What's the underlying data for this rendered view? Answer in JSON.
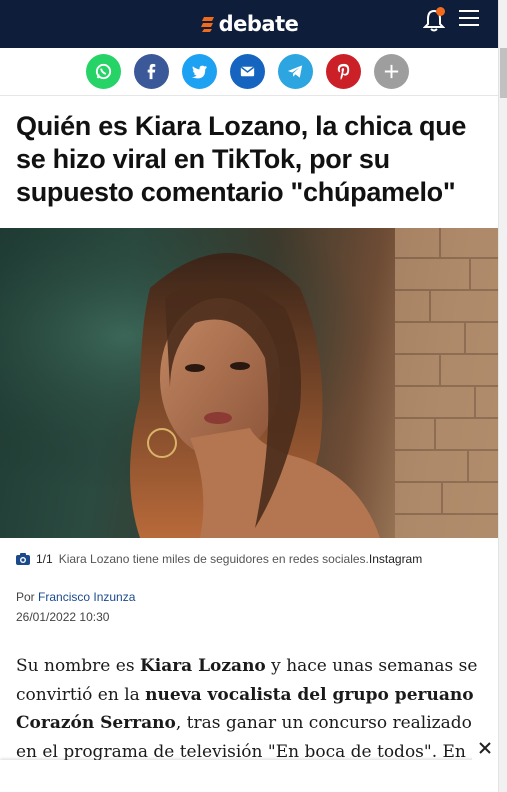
{
  "header": {
    "logo_text": "debate",
    "brand_color": "#0e1e3a",
    "accent_color": "#f26b1d",
    "icons": [
      "bell-icon",
      "menu-icon"
    ]
  },
  "share": {
    "buttons": [
      {
        "name": "whatsapp",
        "color": "#25d366"
      },
      {
        "name": "facebook",
        "color": "#3b5998"
      },
      {
        "name": "twitter",
        "color": "#1da1f2"
      },
      {
        "name": "email",
        "color": "#1565c0"
      },
      {
        "name": "telegram",
        "color": "#2ca5e0"
      },
      {
        "name": "pinterest",
        "color": "#cb2027"
      },
      {
        "name": "more",
        "color": "#9e9e9e"
      }
    ]
  },
  "article": {
    "headline": "Quién es Kiara Lozano, la chica que se hizo viral en TikTok, por su supuesto comentario \"chúpamelo\"",
    "caption": {
      "count": "1/1",
      "text": "Kiara Lozano tiene miles de seguidores en redes sociales.",
      "source": "Instagram"
    },
    "byline_prefix": "Por",
    "author": "Francisco Inzunza",
    "date": "26/01/2022 10:30",
    "body": {
      "t1": "Su nombre es ",
      "b1": "Kiara Lozano",
      "t2": " y hace unas semanas se convirtió en la ",
      "b2": "nueva vocalista del grupo peruano Corazón Serrano",
      "t3": ", tras ganar un concurso realizado en el programa de televisión \"En boca de todos\". En redes"
    }
  }
}
